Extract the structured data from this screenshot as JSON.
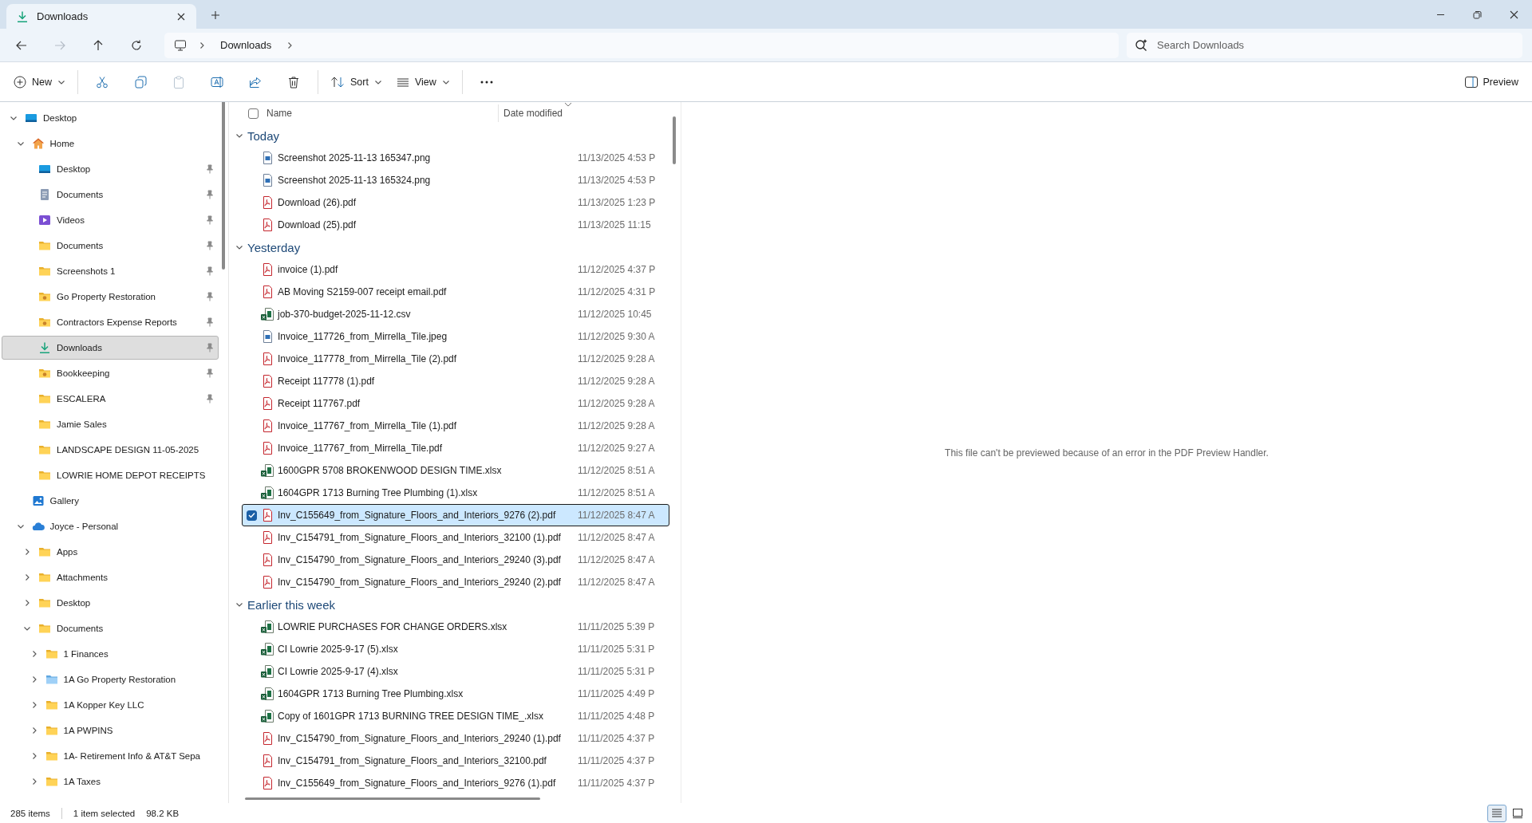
{
  "tab": {
    "title": "Downloads",
    "selected": true
  },
  "navigation": [
    {
      "disabled": false
    },
    {
      "disabled": true
    },
    {
      "disabled": false
    },
    {
      "disabled": false
    }
  ],
  "breadcrumb": [
    "Downloads"
  ],
  "search": {
    "placeholder": "Search Downloads"
  },
  "toolbar": {
    "new_label": "New",
    "buttons": [
      {
        "disabled": false
      },
      {
        "disabled": false
      },
      {
        "disabled": true
      },
      {
        "disabled": false
      },
      {
        "disabled": false
      },
      {
        "disabled": false
      }
    ],
    "sort_label": "Sort",
    "view_label": "View",
    "preview_label": "Preview"
  },
  "sidebar": {
    "items": [
      {
        "label": "Desktop",
        "kind": "desktop",
        "expanded": true,
        "selected": false,
        "children": [
          {
            "label": "Home",
            "kind": "home",
            "expanded": true,
            "selected": false,
            "children": [
              {
                "label": "Desktop",
                "kind": "desktop",
                "pinned": true,
                "selected": false
              },
              {
                "label": "Documents",
                "kind": "documents",
                "pinned": true,
                "selected": false
              },
              {
                "label": "Videos",
                "kind": "videos",
                "pinned": true,
                "selected": false
              },
              {
                "label": "Documents",
                "kind": "folder",
                "pinned": true,
                "selected": false
              },
              {
                "label": "Screenshots 1",
                "kind": "folder",
                "pinned": true,
                "selected": false
              },
              {
                "label": "Go Property Restoration",
                "kind": "folder-special",
                "pinned": true,
                "selected": false
              },
              {
                "label": "Contractors Expense Reports",
                "kind": "folder-special",
                "pinned": true,
                "selected": false
              },
              {
                "label": "Downloads",
                "kind": "download",
                "pinned": true,
                "selected": true
              },
              {
                "label": "Bookkeeping",
                "kind": "folder-special",
                "pinned": true,
                "selected": false
              },
              {
                "label": "ESCALERA",
                "kind": "folder",
                "pinned": true,
                "selected": false
              },
              {
                "label": "Jamie Sales",
                "kind": "folder",
                "pinned": false,
                "selected": false
              },
              {
                "label": "LANDSCAPE DESIGN 11-05-2025",
                "kind": "folder",
                "pinned": false,
                "selected": false
              },
              {
                "label": "LOWRIE HOME DEPOT RECEIPTS",
                "kind": "folder",
                "pinned": false,
                "selected": false
              }
            ]
          },
          {
            "label": "Gallery",
            "kind": "gallery",
            "selected": false
          },
          {
            "label": "Joyce - Personal",
            "kind": "cloud",
            "expanded": true,
            "selected": false,
            "children": [
              {
                "label": "Apps",
                "kind": "folder",
                "expanded": false,
                "selected": false
              },
              {
                "label": "Attachments",
                "kind": "folder",
                "expanded": false,
                "selected": false
              },
              {
                "label": "Desktop",
                "kind": "folder",
                "expanded": false,
                "selected": false
              },
              {
                "label": "Documents",
                "kind": "folder",
                "expanded": true,
                "selected": false,
                "children": [
                  {
                    "label": "1 Finances",
                    "kind": "folder",
                    "expanded": false,
                    "selected": false
                  },
                  {
                    "label": "1A Go Property Restoration",
                    "kind": "folder-blue",
                    "expanded": false,
                    "selected": false
                  },
                  {
                    "label": "1A Kopper Key LLC",
                    "kind": "folder",
                    "expanded": false,
                    "selected": false
                  },
                  {
                    "label": "1A PWPINS",
                    "kind": "folder",
                    "expanded": false,
                    "selected": false
                  },
                  {
                    "label": "1A- Retirement Info & AT&T Sepa",
                    "kind": "folder",
                    "expanded": false,
                    "selected": false
                  },
                  {
                    "label": "1A Taxes",
                    "kind": "folder",
                    "expanded": false,
                    "selected": false
                  }
                ]
              }
            ]
          }
        ]
      }
    ]
  },
  "columns": [
    "Name",
    "Date modified"
  ],
  "select_all": {
    "checked": false
  },
  "groups": [
    {
      "label": "Today",
      "expanded": true,
      "files": [
        {
          "kind": "image",
          "name": "Screenshot 2025-11-13 165347.png",
          "date": "11/13/2025 4:53 P",
          "selected": false
        },
        {
          "kind": "image",
          "name": "Screenshot 2025-11-13 165324.png",
          "date": "11/13/2025 4:53 P",
          "selected": false
        },
        {
          "kind": "pdf",
          "name": "Download (26).pdf",
          "date": "11/13/2025 1:23 P",
          "selected": false
        },
        {
          "kind": "pdf",
          "name": "Download (25).pdf",
          "date": "11/13/2025 11:15",
          "selected": false
        }
      ]
    },
    {
      "label": "Yesterday",
      "expanded": true,
      "files": [
        {
          "kind": "pdf",
          "name": "invoice (1).pdf",
          "date": "11/12/2025 4:37 P",
          "selected": false
        },
        {
          "kind": "pdf",
          "name": "AB Moving S2159-007 receipt email.pdf",
          "date": "11/12/2025 4:31 P",
          "selected": false
        },
        {
          "kind": "sheet",
          "name": "job-370-budget-2025-11-12.csv",
          "date": "11/12/2025 10:45",
          "selected": false
        },
        {
          "kind": "image",
          "name": "Invoice_117726_from_Mirrella_Tile.jpeg",
          "date": "11/12/2025 9:30 A",
          "selected": false
        },
        {
          "kind": "pdf",
          "name": "Invoice_117778_from_Mirrella_Tile (2).pdf",
          "date": "11/12/2025 9:28 A",
          "selected": false
        },
        {
          "kind": "pdf",
          "name": "Receipt 117778 (1).pdf",
          "date": "11/12/2025 9:28 A",
          "selected": false
        },
        {
          "kind": "pdf",
          "name": "Receipt 117767.pdf",
          "date": "11/12/2025 9:28 A",
          "selected": false
        },
        {
          "kind": "pdf",
          "name": "Invoice_117767_from_Mirrella_Tile (1).pdf",
          "date": "11/12/2025 9:28 A",
          "selected": false
        },
        {
          "kind": "pdf",
          "name": "Invoice_117767_from_Mirrella_Tile.pdf",
          "date": "11/12/2025 9:27 A",
          "selected": false
        },
        {
          "kind": "sheet",
          "name": "1600GPR 5708 BROKENWOOD DESIGN TIME.xlsx",
          "date": "11/12/2025 8:51 A",
          "selected": false
        },
        {
          "kind": "sheet",
          "name": "1604GPR 1713 Burning Tree Plumbing (1).xlsx",
          "date": "11/12/2025 8:51 A",
          "selected": false
        },
        {
          "kind": "pdf",
          "name": "Inv_C155649_from_Signature_Floors_and_Interiors_9276 (2).pdf",
          "date": "11/12/2025 8:47 A",
          "selected": true
        },
        {
          "kind": "pdf",
          "name": "Inv_C154791_from_Signature_Floors_and_Interiors_32100 (1).pdf",
          "date": "11/12/2025 8:47 A",
          "selected": false
        },
        {
          "kind": "pdf",
          "name": "Inv_C154790_from_Signature_Floors_and_Interiors_29240 (3).pdf",
          "date": "11/12/2025 8:47 A",
          "selected": false
        },
        {
          "kind": "pdf",
          "name": "Inv_C154790_from_Signature_Floors_and_Interiors_29240 (2).pdf",
          "date": "11/12/2025 8:47 A",
          "selected": false
        }
      ]
    },
    {
      "label": "Earlier this week",
      "expanded": true,
      "files": [
        {
          "kind": "sheet",
          "name": "LOWRIE PURCHASES FOR CHANGE ORDERS.xlsx",
          "date": "11/11/2025 5:39 P",
          "selected": false
        },
        {
          "kind": "sheet",
          "name": "CI Lowrie 2025-9-17 (5).xlsx",
          "date": "11/11/2025 5:31 P",
          "selected": false
        },
        {
          "kind": "sheet",
          "name": "CI Lowrie 2025-9-17 (4).xlsx",
          "date": "11/11/2025 5:31 P",
          "selected": false
        },
        {
          "kind": "sheet",
          "name": "1604GPR 1713 Burning Tree Plumbing.xlsx",
          "date": "11/11/2025 4:49 P",
          "selected": false
        },
        {
          "kind": "sheet",
          "name": "Copy of 1601GPR 1713 BURNING TREE DESIGN TIME_.xlsx",
          "date": "11/11/2025 4:48 P",
          "selected": false
        },
        {
          "kind": "pdf",
          "name": "Inv_C154790_from_Signature_Floors_and_Interiors_29240 (1).pdf",
          "date": "11/11/2025 4:37 P",
          "selected": false
        },
        {
          "kind": "pdf",
          "name": "Inv_C154791_from_Signature_Floors_and_Interiors_32100.pdf",
          "date": "11/11/2025 4:37 P",
          "selected": false
        },
        {
          "kind": "pdf",
          "name": "Inv_C155649_from_Signature_Floors_and_Interiors_9276 (1).pdf",
          "date": "11/11/2025 4:37 P",
          "selected": false
        }
      ]
    }
  ],
  "preview": {
    "message": "This file can't be previewed because of an error in the PDF Preview Handler."
  },
  "status_bar": {
    "item_count": "285 items",
    "selection": "1 item selected",
    "size": "98.2 KB"
  },
  "view_modes": [
    {
      "selected": true
    },
    {
      "selected": false
    }
  ]
}
